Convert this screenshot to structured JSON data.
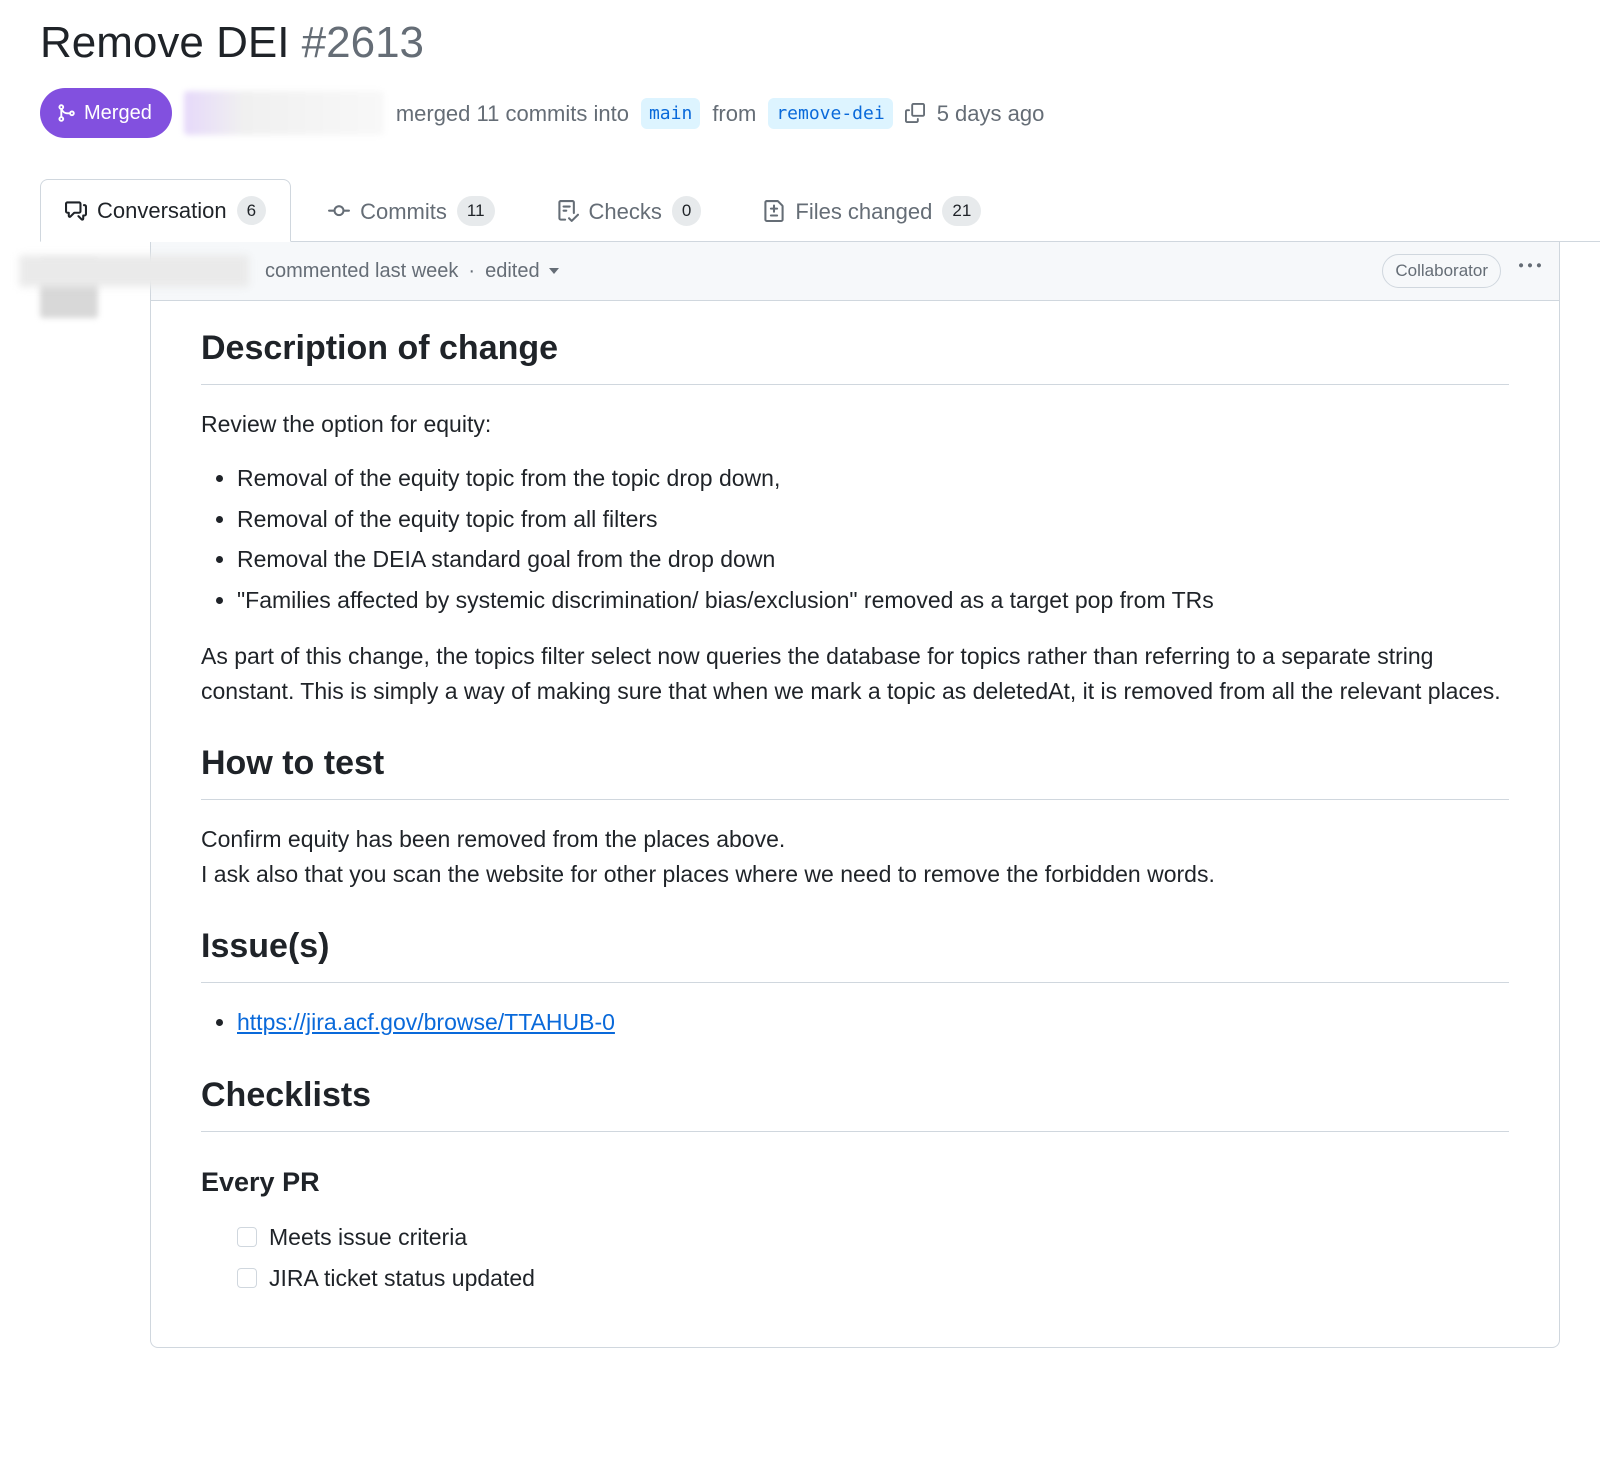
{
  "header": {
    "title": "Remove DEI",
    "number": "#2613",
    "state": "Merged",
    "meta_prefix": "merged 11 commits into",
    "base_branch": "main",
    "meta_mid": "from",
    "head_branch": "remove-dei",
    "timestamp": "5 days ago"
  },
  "tabs": [
    {
      "label": "Conversation",
      "count": "6",
      "selected": true,
      "icon": "comment"
    },
    {
      "label": "Commits",
      "count": "11",
      "selected": false,
      "icon": "commit"
    },
    {
      "label": "Checks",
      "count": "0",
      "selected": false,
      "icon": "checklist"
    },
    {
      "label": "Files changed",
      "count": "21",
      "selected": false,
      "icon": "diff"
    }
  ],
  "comment": {
    "meta": "commented last week",
    "edited": "edited",
    "role": "Collaborator",
    "sections": {
      "desc_heading": "Description of change",
      "desc_intro": "Review the option for equity:",
      "desc_bullets": [
        "Removal of the equity topic from the topic drop down,",
        "Removal of the equity topic from all filters",
        "Removal the DEIA standard goal from the drop down",
        "\"Families affected by systemic discrimination/ bias/exclusion\" removed as a target pop from TRs"
      ],
      "desc_para": "As part of this change, the topics filter select now queries the database for topics rather than referring to a separate string constant. This is simply a way of making sure that when we mark a topic as deletedAt, it is removed from all the relevant places.",
      "test_heading": "How to test",
      "test_line1": "Confirm equity has been removed from the places above.",
      "test_line2": "I ask also that you scan the website for other places where we need to remove the forbidden words.",
      "issues_heading": "Issue(s)",
      "issue_link": "https://jira.acf.gov/browse/TTAHUB-0",
      "checklists_heading": "Checklists",
      "every_pr_heading": "Every PR",
      "every_pr_items": [
        "Meets issue criteria",
        "JIRA ticket status updated"
      ]
    }
  }
}
